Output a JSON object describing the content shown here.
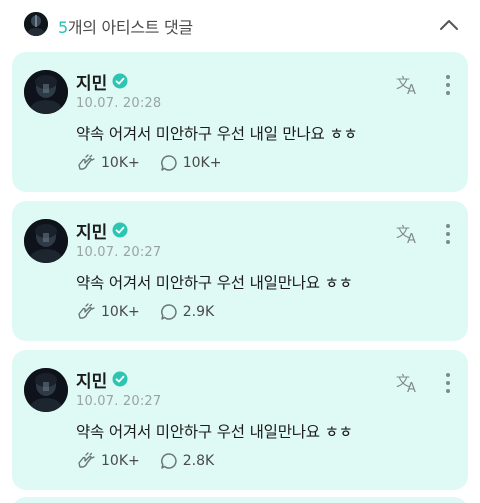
{
  "header": {
    "count": "5",
    "title_suffix": "개의 아티스트 댓글",
    "collapse_icon": "chevron-up-icon"
  },
  "colors": {
    "accent": "#27c2b0",
    "card_background": "#dffaf4",
    "verified_badge": "#2cc4b2"
  },
  "comments": [
    {
      "author": "지민",
      "date": "10.07. 20:28",
      "text": "약속 어겨서 미안하구 우선 내일 만나요 ㅎㅎ",
      "likes": "10K+",
      "replies": "10K+"
    },
    {
      "author": "지민",
      "date": "10.07. 20:27",
      "text": "약속 어겨서 미안하구 우선 내일만나요 ㅎㅎ",
      "likes": "10K+",
      "replies": "2.9K"
    },
    {
      "author": "지민",
      "date": "10.07. 20:27",
      "text": "약속 어겨서 미안하구 우선 내일만나요 ㅎㅎ",
      "likes": "10K+",
      "replies": "2.8K"
    }
  ],
  "icons": {
    "verified": "verified-check-icon",
    "translate": "translate-icon",
    "more": "more-vertical-icon",
    "like": "like-hands-icon",
    "reply": "comment-bubble-icon"
  }
}
